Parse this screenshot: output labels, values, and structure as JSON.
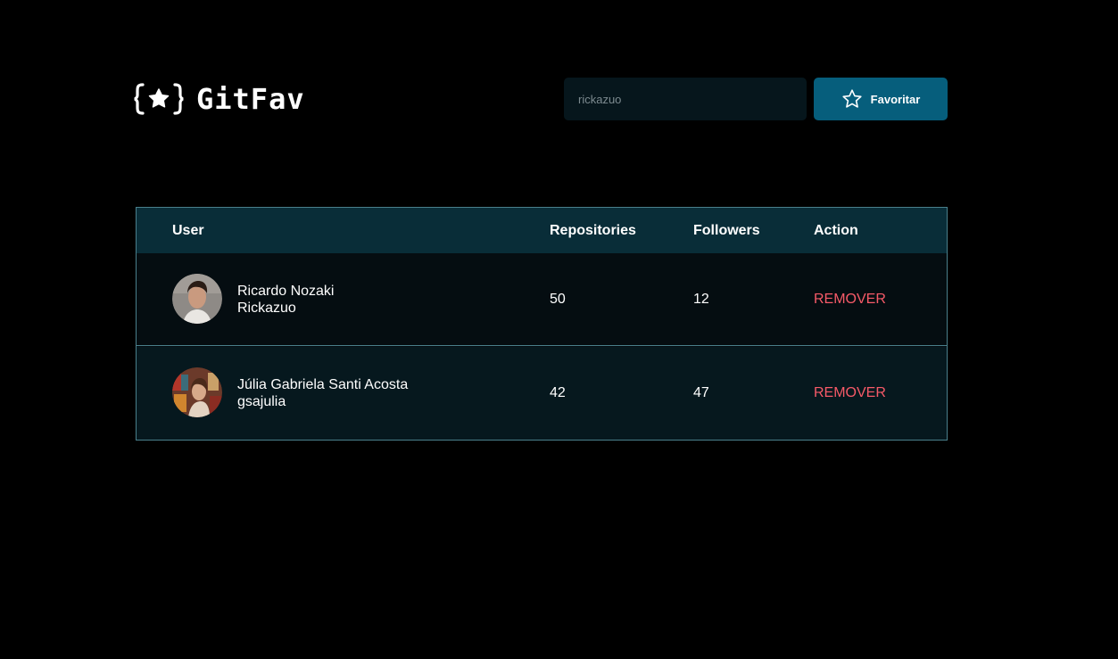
{
  "header": {
    "logo_text": "GitFav",
    "search": {
      "value": "",
      "placeholder": "rickazuo"
    },
    "favorite_button_label": "Favoritar"
  },
  "table": {
    "columns": {
      "user": "User",
      "repositories": "Repositories",
      "followers": "Followers",
      "action": "Action"
    },
    "rows": [
      {
        "name": "Ricardo Nozaki",
        "login": "Rickazuo",
        "repositories": "50",
        "followers": "12",
        "action": "REMOVER"
      },
      {
        "name": "Júlia Gabriela Santi Acosta",
        "login": "gsajulia",
        "repositories": "42",
        "followers": "47",
        "action": "REMOVER"
      }
    ]
  },
  "colors": {
    "background": "#000000",
    "input_bg": "#06161c",
    "button_bg": "#065e7c",
    "table_header_bg": "#092d38",
    "table_border": "#4a808c",
    "remove_text": "#f75a68"
  },
  "icons": {
    "logo": "braces-star-icon",
    "button": "star-outline-icon",
    "avatars": [
      "user-avatar-photo",
      "user-avatar-photo"
    ]
  }
}
